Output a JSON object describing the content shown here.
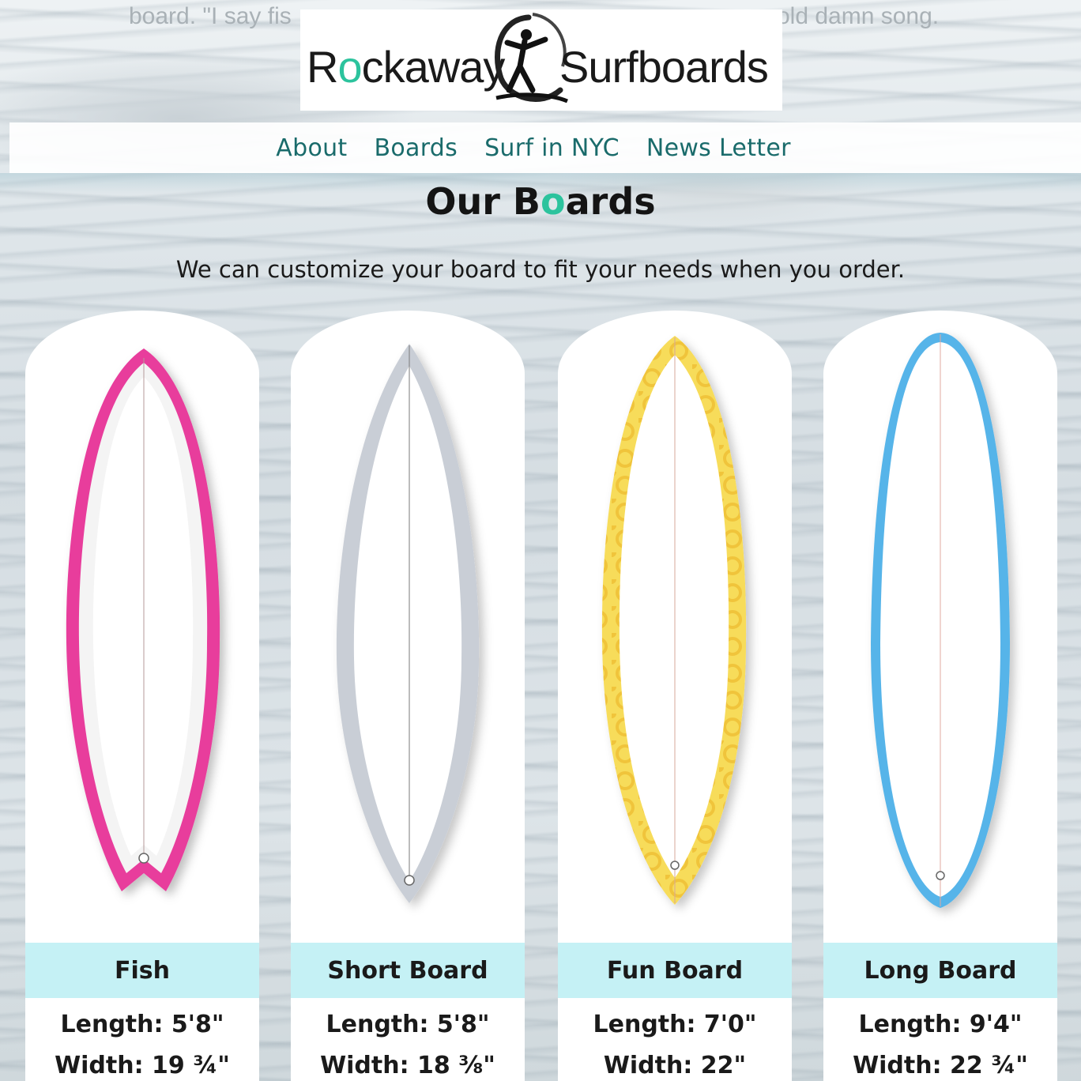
{
  "teaser": {
    "left_text": "board. \"I say fis",
    "right_text": "old damn song."
  },
  "logo": {
    "part1": "Rockaway",
    "part2": "Surfboards"
  },
  "nav": {
    "items": [
      "About",
      "Boards",
      "Surf in NYC",
      "News Letter"
    ]
  },
  "page": {
    "title_pre": "Our B",
    "title_o": "o",
    "title_post": "ards",
    "subtitle": "We can customize your board to fit your needs when you order."
  },
  "boards": [
    {
      "name": "Fish",
      "length": "Length: 5'8\"",
      "width": "Width: 19 ¾\"",
      "rail_color": "#e83e9c"
    },
    {
      "name": "Short Board",
      "length": "Length: 5'8\"",
      "width": "Width: 18 ⅜\"",
      "rail_color": "#c9ced6"
    },
    {
      "name": "Fun Board",
      "length": "Length: 7'0\"",
      "width": "Width: 22\"",
      "rail_color": "#f3d444"
    },
    {
      "name": "Long Board",
      "length": "Length: 9'4\"",
      "width": "Width: 22 ¾\"",
      "rail_color": "#56b4e9"
    }
  ],
  "colors": {
    "accent": "#2cc39d",
    "nav_text": "#1a6b6b",
    "name_band": "#c5f1f5"
  }
}
